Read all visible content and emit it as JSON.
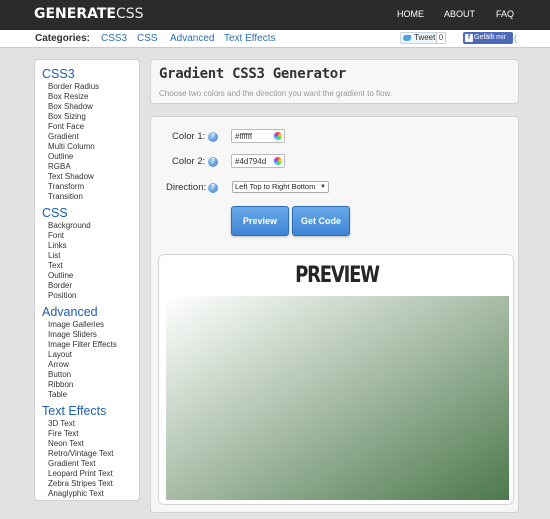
{
  "brand": {
    "bold": "GENERATE",
    "light": "CSS"
  },
  "topnav": [
    "HOME",
    "ABOUT",
    "FAQ"
  ],
  "categories": {
    "label": "Categories:",
    "links": [
      "CSS3",
      "CSS",
      "Advanced",
      "Text Effects"
    ]
  },
  "social": {
    "tweet": "Tweet",
    "tweet_count": "0",
    "facebook": "Gefällt mir"
  },
  "sidebar": [
    {
      "heading": "CSS3",
      "items": [
        "Border Radius",
        "Box Resize",
        "Box Shadow",
        "Box Sizing",
        "Font Face",
        "Gradient",
        "Multi Column",
        "Outline",
        "RGBA",
        "Text Shadow",
        "Transform",
        "Transition"
      ]
    },
    {
      "heading": "CSS",
      "items": [
        "Background",
        "Font",
        "Links",
        "List",
        "Text",
        "Outline",
        "Border",
        "Position"
      ]
    },
    {
      "heading": "Advanced",
      "items": [
        "Image Galleries",
        "Image Sliders",
        "Image Filter Effects",
        "Layout",
        "Arrow",
        "Button",
        "Ribbon",
        "Table"
      ]
    },
    {
      "heading": "Text Effects",
      "items": [
        "3D Text",
        "Fire Text",
        "Neon Text",
        "Retro/Vintage Text",
        "Gradient Text",
        "Leopard Print Text",
        "Zebra Stripes Text",
        "Anaglyphic Text"
      ]
    }
  ],
  "page": {
    "title": "Gradient CSS3 Generator",
    "subtitle": "Choose two colors and the direction you want the gradient to flow."
  },
  "form": {
    "color1_label": "Color 1:",
    "color1_value": "#ffffff",
    "color2_label": "Color 2:",
    "color2_value": "#4d794d",
    "direction_label": "Direction:",
    "direction_value": "Left Top to Right Bottom",
    "help_glyph": "?",
    "caret": "▼"
  },
  "buttons": {
    "preview": "Preview",
    "get_code": "Get Code"
  },
  "preview": {
    "title": "PREVIEW"
  },
  "colors": {
    "accent": "#1f5fb0",
    "gradient_start": "#ffffff",
    "gradient_end": "#4d794d"
  }
}
